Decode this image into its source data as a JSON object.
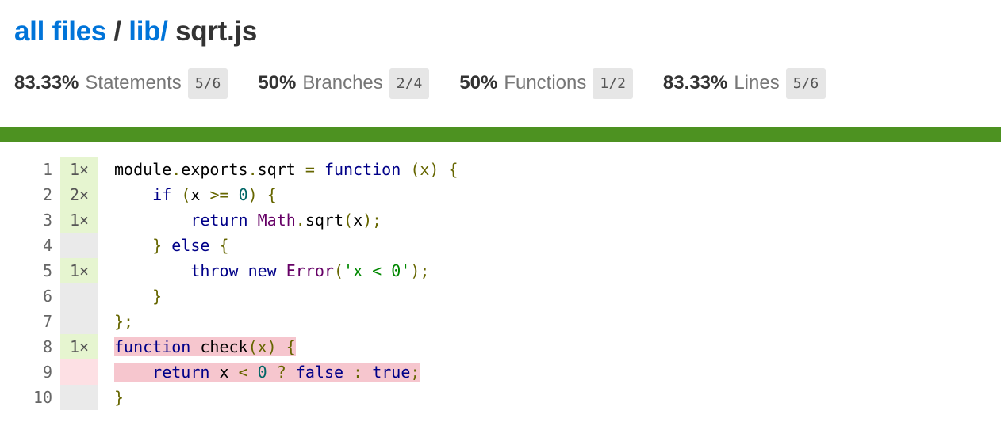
{
  "breadcrumb": {
    "root": "all files",
    "sep1": "/",
    "folder": "lib/",
    "file": "sqrt.js"
  },
  "summary": {
    "statements": {
      "percent": "83.33%",
      "label": "Statements",
      "fraction": "5/6"
    },
    "branches": {
      "percent": "50%",
      "label": "Branches",
      "fraction": "2/4"
    },
    "functions": {
      "percent": "50%",
      "label": "Functions",
      "fraction": "1/2"
    },
    "lines": {
      "percent": "83.33%",
      "label": "Lines",
      "fraction": "5/6"
    }
  },
  "colors": {
    "link": "#0074d9",
    "status_bar": "#4d9221",
    "hit_count_bg": "#e6f5d0",
    "neutral_count_bg": "#eaeaea",
    "miss_count_bg": "#fde0e4",
    "uncovered_highlight": "#f6c6ce"
  },
  "code": {
    "line_numbers": [
      "1",
      "2",
      "3",
      "4",
      "5",
      "6",
      "7",
      "8",
      "9",
      "10"
    ],
    "counts": [
      "1×",
      "2×",
      "1×",
      "",
      "1×",
      "",
      "",
      "1×",
      "",
      ""
    ],
    "tokens": {
      "module": "module",
      "dot1": ".",
      "exports": "exports",
      "dot2": ".",
      "sqrt": "sqrt",
      "eq": " = ",
      "function": "function",
      "paren_x": "(x)",
      "brace_open": "{",
      "if": "if",
      "lparen": "(",
      "x": "x",
      "gte": ">=",
      "zero": "0",
      "rparen": ")",
      "return": "return",
      "Math": "Math",
      "sqrt_call": "sqrt",
      "arg_x": "x",
      "close_call": ");",
      "brace_close": "}",
      "else": "else",
      "throw": "throw",
      "new": "new",
      "Error": "Error",
      "str": "'x < 0'",
      "semi_end": "};",
      "check": "check",
      "lt": "<",
      "qmark": "?",
      "false": "false",
      "colon": ":",
      "true": "true",
      "semi": ";"
    }
  }
}
